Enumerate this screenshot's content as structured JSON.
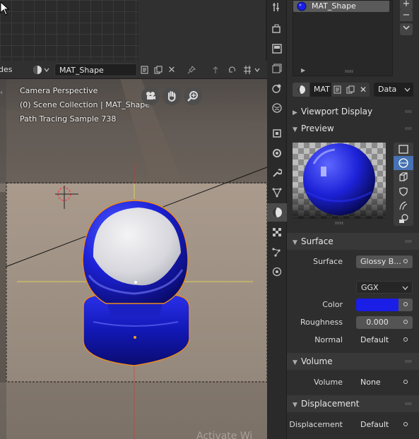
{
  "header": {
    "editor_type_partial": "des",
    "material_name": "MAT_Shape"
  },
  "viewport": {
    "camera_label": "Camera Perspective",
    "collection_label": "(0) Scene Collection | MAT_Shape",
    "sample_label": "Path Tracing Sample 738",
    "watermark": "Activate Wi"
  },
  "material_slots": {
    "items": [
      "MAT_Shape"
    ],
    "add": "+",
    "remove": "−"
  },
  "material_selector": {
    "name": "MAT",
    "link": "Data"
  },
  "sections": {
    "viewport_display": "Viewport Display",
    "preview": "Preview",
    "surface": "Surface",
    "volume": "Volume",
    "displacement": "Displacement"
  },
  "surface": {
    "surface_label": "Surface",
    "surface_value": "Glossy B...",
    "distribution": "GGX",
    "color_label": "Color",
    "color_value": "#1a1ee6",
    "roughness_label": "Roughness",
    "roughness_value": "0.000",
    "normal_label": "Normal",
    "normal_value": "Default"
  },
  "volume": {
    "volume_label": "Volume",
    "volume_value": "None"
  },
  "displacement": {
    "displacement_label": "Displacement",
    "displacement_value": "Default"
  },
  "colors": {
    "accent": "#4772b3",
    "material_blue": "#1a1ee6",
    "selection_outline": "#f08a1c"
  }
}
